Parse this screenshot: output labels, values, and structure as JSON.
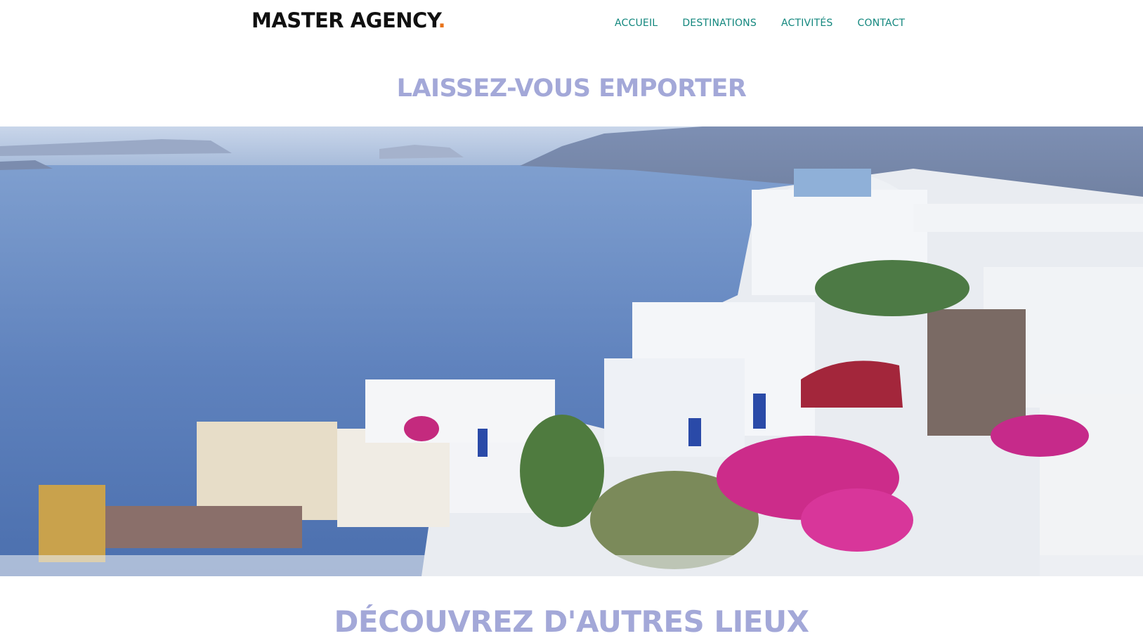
{
  "header": {
    "logo_text": "MASTER AGENCY",
    "logo_dot": ".",
    "nav": [
      {
        "label": "ACCUEIL"
      },
      {
        "label": "DESTINATIONS"
      },
      {
        "label": "ACTIVITÉS"
      },
      {
        "label": "CONTACT"
      }
    ]
  },
  "hero": {
    "title": "LAISSEZ-VOUS EMPORTER",
    "image_icon": "santorini-village-photo"
  },
  "section": {
    "title": "DÉCOUVREZ D'AUTRES LIEUX"
  },
  "colors": {
    "nav": "#13877e",
    "title": "#a3a8d8",
    "logo_dot": "#e8731a"
  }
}
